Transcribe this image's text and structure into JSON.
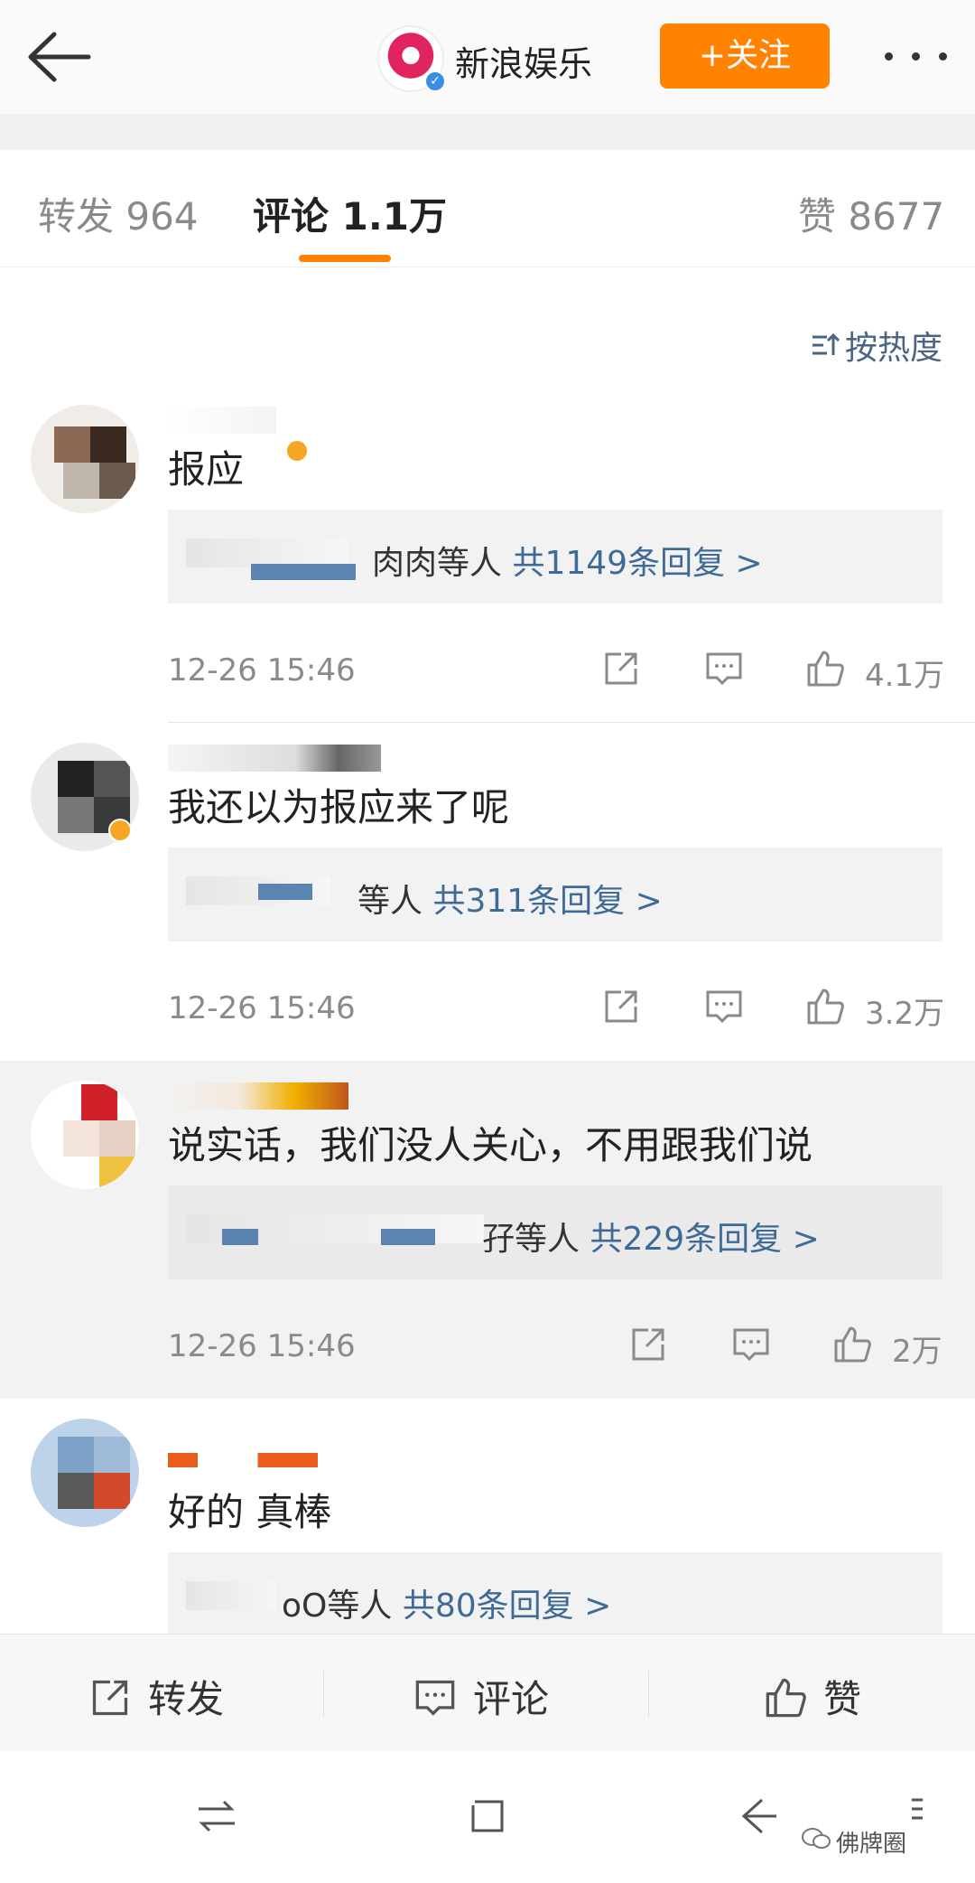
{
  "header": {
    "account_name": "新浪娱乐",
    "follow_label": "+关注",
    "icons": [
      "back-arrow-icon",
      "verified-icon",
      "more-icon"
    ]
  },
  "tabs": [
    {
      "label": "转发 964"
    },
    {
      "label": "评论 1.1万",
      "active": true
    },
    {
      "label": "赞 8677"
    }
  ],
  "sort_label": "按热度",
  "comments": [
    {
      "text": "报应",
      "reply_suffix": "肉肉等人",
      "reply_count": "共1149条回复 >",
      "time": "12-26 15:46",
      "likes": "4.1万"
    },
    {
      "text": "我还以为报应来了呢",
      "reply_suffix": "等人",
      "reply_count": "共311条回复 >",
      "time": "12-26 15:46",
      "likes": "3.2万"
    },
    {
      "text": "说实话，我们没人关心，不用跟我们说",
      "reply_suffix": "孖等人",
      "reply_count": "共229条回复 >",
      "time": "12-26 15:46",
      "likes": "2万"
    },
    {
      "text": "好的 真棒",
      "reply_suffix": "oO等人",
      "reply_count": "共80条回复 >"
    }
  ],
  "actionbar": {
    "repost": "转发",
    "comment": "评论",
    "like": "赞"
  },
  "watermark": "佛牌圈",
  "colors": {
    "accent": "#ff8200",
    "link": "#3f6a97",
    "muted": "#8a8a8a"
  }
}
